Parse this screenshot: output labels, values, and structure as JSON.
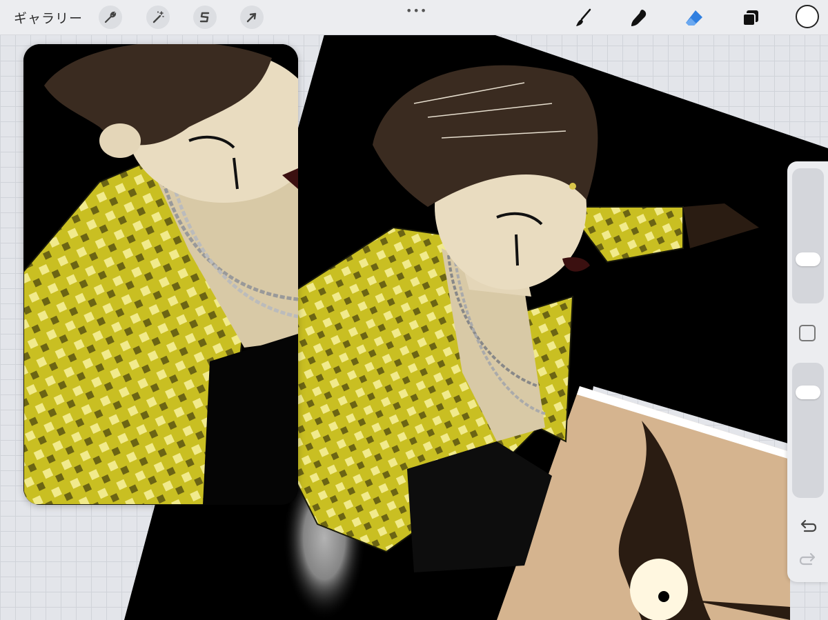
{
  "toolbar": {
    "gallery_label": "ギャラリー",
    "left_tools": [
      {
        "name": "actions",
        "icon": "wrench-icon"
      },
      {
        "name": "adjustments",
        "icon": "magic-wand-icon"
      },
      {
        "name": "selection",
        "icon": "selection-s-icon"
      },
      {
        "name": "transform",
        "icon": "arrow-cursor-icon"
      }
    ],
    "handle_glyph": "•••",
    "right_tools": [
      {
        "name": "brush",
        "icon": "brush-icon",
        "active": false
      },
      {
        "name": "smudge",
        "icon": "smudge-icon",
        "active": false
      },
      {
        "name": "eraser",
        "icon": "eraser-icon",
        "active": true
      },
      {
        "name": "layers",
        "icon": "layers-icon",
        "active": false
      }
    ],
    "current_color": "#ffffff",
    "active_color": "#2f7fe0"
  },
  "sidebar": {
    "brush_size_level": 0.45,
    "opacity_level": 0.8
  },
  "colors": {
    "jacket_yellow": "#d9cf2a",
    "skin": "#e9dcc0",
    "hair": "#3a2b20",
    "canvas_black": "#000000",
    "panel_skin": "#d5b48f"
  }
}
